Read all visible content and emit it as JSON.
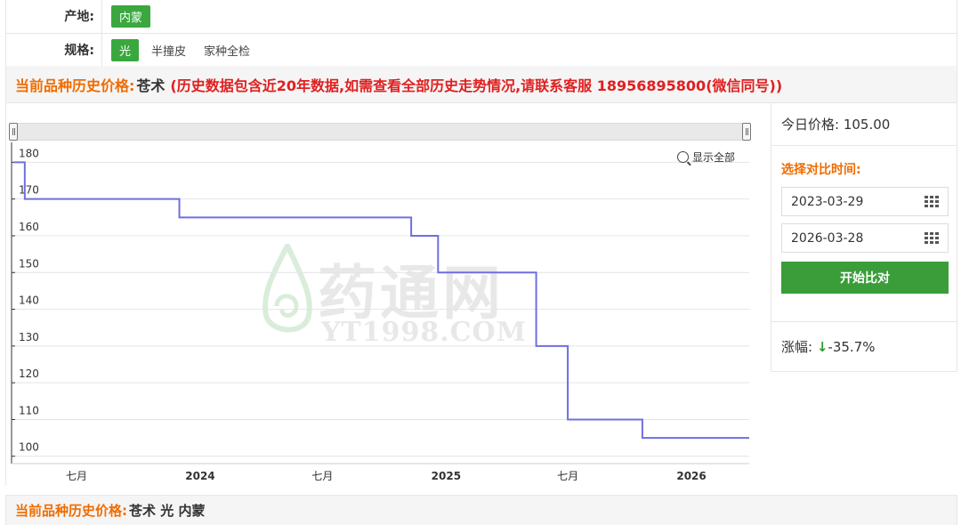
{
  "filters": {
    "origin": {
      "label": "产地:",
      "options": [
        "内蒙"
      ],
      "active": 0
    },
    "spec": {
      "label": "规格:",
      "options": [
        "光",
        "半撞皮",
        "家种全检"
      ],
      "active": 0
    }
  },
  "history_header": {
    "prefix": "当前品种历史价格:",
    "name": "苍术",
    "note": "(历史数据包含近20年数据,如需查看全部历史走势情况,请联系客服 18956895800(微信同号))"
  },
  "chart": {
    "zoom_label": "显示全部",
    "watermark_cn": "药通网",
    "watermark_en": "YT1998.COM"
  },
  "chart_data": {
    "type": "line",
    "step": true,
    "ylim": [
      98,
      183
    ],
    "yticks": [
      100,
      110,
      120,
      130,
      140,
      150,
      160,
      170,
      180
    ],
    "xticks": [
      {
        "label": "七月",
        "date": "2023-07-01",
        "bold": false
      },
      {
        "label": "2024",
        "date": "2024-01-01",
        "bold": true
      },
      {
        "label": "七月",
        "date": "2024-07-01",
        "bold": false
      },
      {
        "label": "2025",
        "date": "2025-01-01",
        "bold": true
      },
      {
        "label": "七月",
        "date": "2025-07-01",
        "bold": false
      },
      {
        "label": "2026",
        "date": "2026-01-01",
        "bold": true
      }
    ],
    "xlim": [
      "2023-03-29",
      "2026-03-28"
    ],
    "series": [
      {
        "color": "#6f6fe0",
        "points": [
          [
            "2023-03-29",
            180
          ],
          [
            "2023-04-15",
            170
          ],
          [
            "2023-12-01",
            165
          ],
          [
            "2024-11-10",
            160
          ],
          [
            "2024-12-20",
            150
          ],
          [
            "2025-05-15",
            130
          ],
          [
            "2025-07-01",
            110
          ],
          [
            "2025-10-20",
            105
          ],
          [
            "2026-03-28",
            105
          ]
        ]
      }
    ]
  },
  "side": {
    "today_label": "今日价格:",
    "today_value": "105.00",
    "compare_title": "选择对比时间:",
    "start_date": "2023-03-29",
    "end_date": "2026-03-28",
    "compare_button": "开始比对",
    "change_label": "涨幅:",
    "change_arrow": "↓",
    "change_value": "-35.7%"
  },
  "bottom": {
    "prefix": "当前品种历史价格:",
    "name": "苍术 光 内蒙"
  }
}
